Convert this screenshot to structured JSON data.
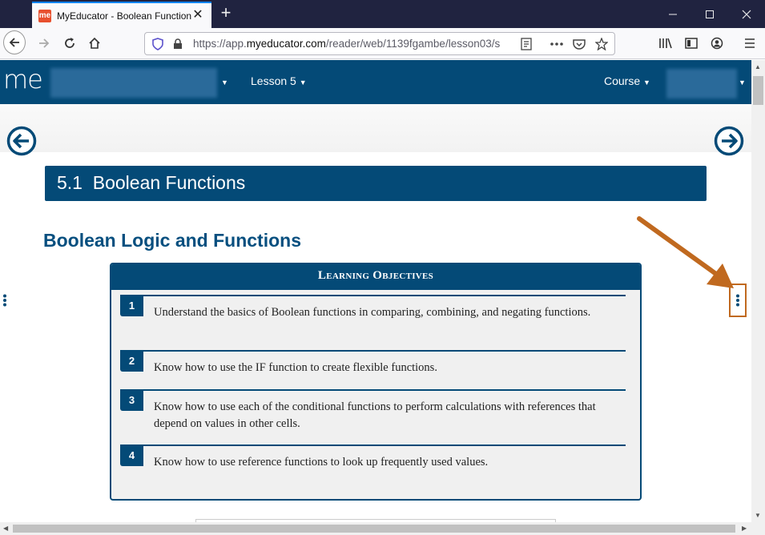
{
  "browser": {
    "tab_title": "MyEducator - Boolean Functions",
    "favicon_text": "me",
    "url_prefix": "https://app.",
    "url_domain": "myeducator.com",
    "url_path": "/reader/web/1139fgambe/lesson03/s"
  },
  "app": {
    "logo": "me",
    "nav_lesson": "Lesson 5",
    "nav_course": "Course"
  },
  "section": {
    "title": "5.1  Boolean Functions",
    "heading": "Boolean Logic and Functions"
  },
  "objectives": {
    "header": "Learning Objectives",
    "items": [
      {
        "num": "1",
        "text": "Understand the basics of Boolean functions in comparing, combining, and negating functions."
      },
      {
        "num": "2",
        "text": "Know how to use the IF function to create flexible functions."
      },
      {
        "num": "3",
        "text": "Know how to use each of the conditional functions to perform calculations with references that depend on values in other cells."
      },
      {
        "num": "4",
        "text": "Know how to use reference functions to look up frequently used values."
      }
    ]
  },
  "colors": {
    "brand": "#044a77",
    "highlight": "#c0691f"
  }
}
